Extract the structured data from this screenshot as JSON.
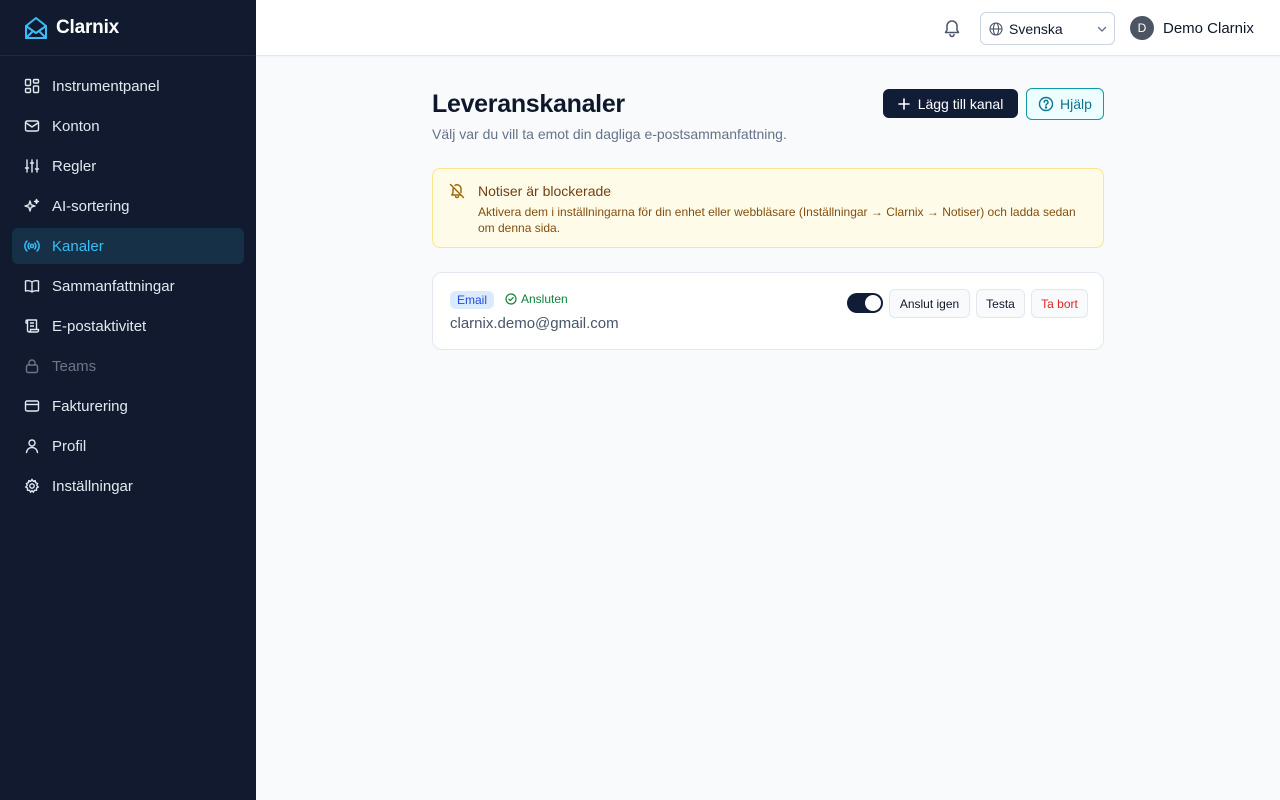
{
  "app": {
    "name": "Clarnix"
  },
  "sidebar": {
    "items": [
      {
        "label": "Instrumentpanel",
        "icon": "dashboard-icon",
        "active": false
      },
      {
        "label": "Konton",
        "icon": "mail-icon",
        "active": false
      },
      {
        "label": "Regler",
        "icon": "sliders-icon",
        "active": false
      },
      {
        "label": "AI-sortering",
        "icon": "sparkles-icon",
        "active": false
      },
      {
        "label": "Kanaler",
        "icon": "radio-icon",
        "active": true
      },
      {
        "label": "Sammanfattningar",
        "icon": "book-icon",
        "active": false
      },
      {
        "label": "E-postaktivitet",
        "icon": "scroll-icon",
        "active": false
      },
      {
        "label": "Teams",
        "icon": "lock-icon",
        "active": false,
        "disabled": true
      },
      {
        "label": "Fakturering",
        "icon": "credit-card-icon",
        "active": false
      },
      {
        "label": "Profil",
        "icon": "user-icon",
        "active": false
      },
      {
        "label": "Inställningar",
        "icon": "gear-icon",
        "active": false
      }
    ]
  },
  "topbar": {
    "language": "Svenska",
    "user_initial": "D",
    "user_name": "Demo Clarnix"
  },
  "page": {
    "title": "Leveranskanaler",
    "subtitle": "Välj var du vill ta emot din dagliga e-postsammanfattning.",
    "add_button": "Lägg till kanal",
    "help_button": "Hjälp"
  },
  "alert": {
    "title": "Notiser är blockerade",
    "body": "Aktivera dem i inställningarna för din enhet eller webbläsare (Inställningar → Clarnix → Notiser) och ladda sedan om denna sida."
  },
  "channel": {
    "type": "Email",
    "status": "Ansluten",
    "address": "clarnix.demo@gmail.com",
    "enabled": true,
    "reconnect_label": "Anslut igen",
    "test_label": "Testa",
    "remove_label": "Ta bort"
  },
  "colors": {
    "sidebar_bg": "#111a2e",
    "accent": "#38bdf8",
    "primary_button": "#111c36",
    "help_border": "#0e9aa7",
    "alert_bg": "#fefce8",
    "danger": "#dc2626",
    "success": "#15803d"
  }
}
